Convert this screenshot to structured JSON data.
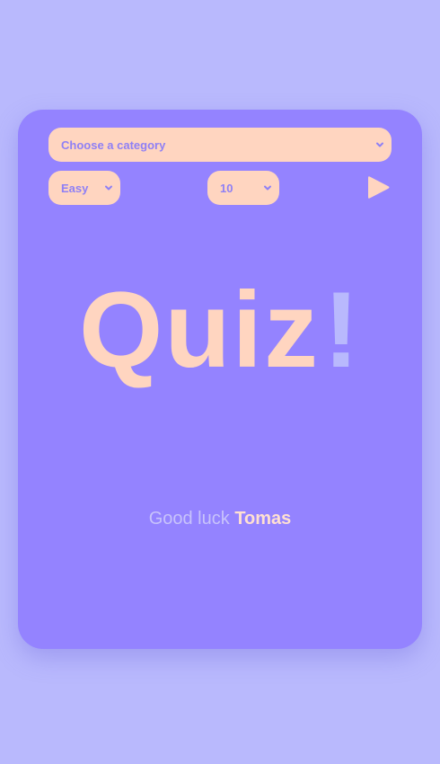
{
  "controls": {
    "category": {
      "selected": "Choose a category"
    },
    "difficulty": {
      "selected": "Easy"
    },
    "amount": {
      "selected": "10"
    },
    "play_icon": "play-icon",
    "chevron_icon": "chevron-down-icon"
  },
  "title": {
    "word": "Quiz",
    "punctuation": "!"
  },
  "greeting": {
    "prefix": "Good luck",
    "name": "Tomas"
  },
  "colors": {
    "background": "#b9b9fd",
    "card": "#9483ff",
    "accent": "#ffd5c0",
    "select_text": "#8f80f5",
    "exclamation": "#b9b9fd",
    "greeting_text": "#c8c3fb",
    "name_text": "#ffe0d2"
  }
}
